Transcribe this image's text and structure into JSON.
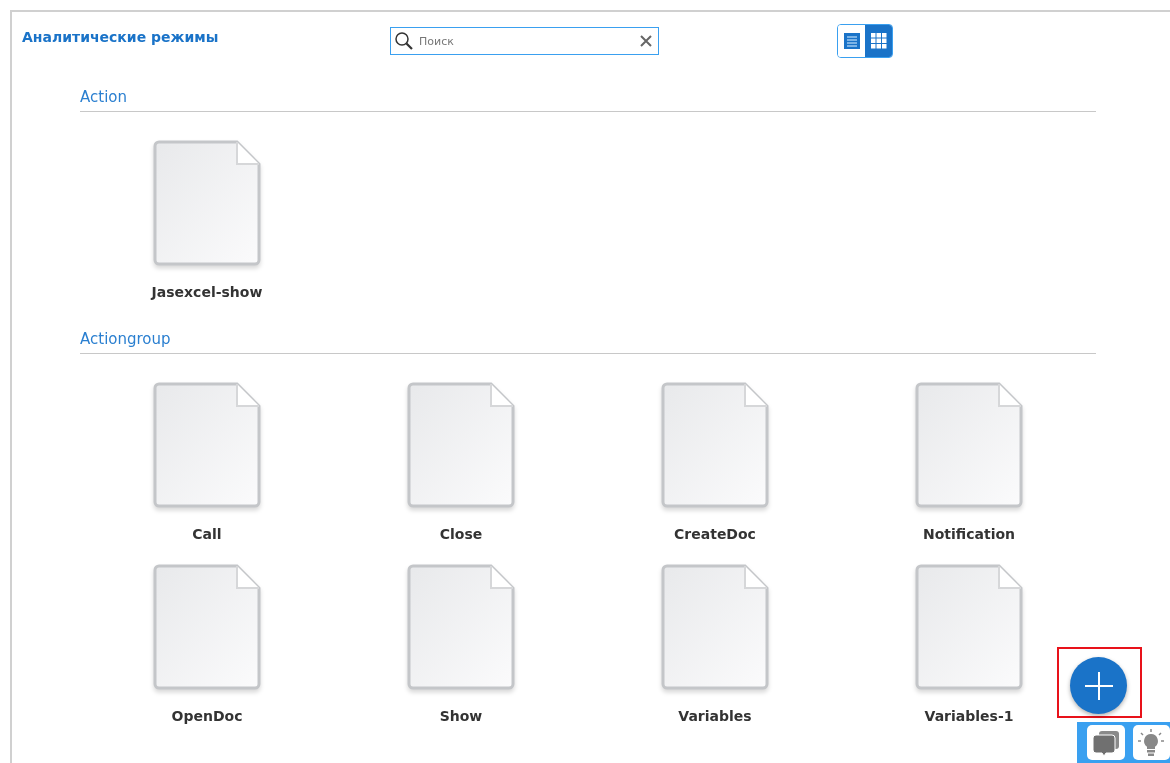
{
  "title": "Аналитические режимы",
  "search": {
    "placeholder": "Поиск"
  },
  "view_toggle": [
    {
      "kind": "list",
      "selected": false
    },
    {
      "kind": "grid",
      "selected": true
    }
  ],
  "sections": [
    {
      "name": "Action",
      "items": [
        "Jasexcel-show"
      ]
    },
    {
      "name": "Actiongroup",
      "items": [
        "Call",
        "Close",
        "CreateDoc",
        "Notification",
        "OpenDoc",
        "Show",
        "Variables",
        "Variables-1"
      ]
    }
  ],
  "add_button": {
    "highlighted": true
  },
  "dock": [
    {
      "kind": "chat"
    },
    {
      "kind": "idea"
    }
  ]
}
